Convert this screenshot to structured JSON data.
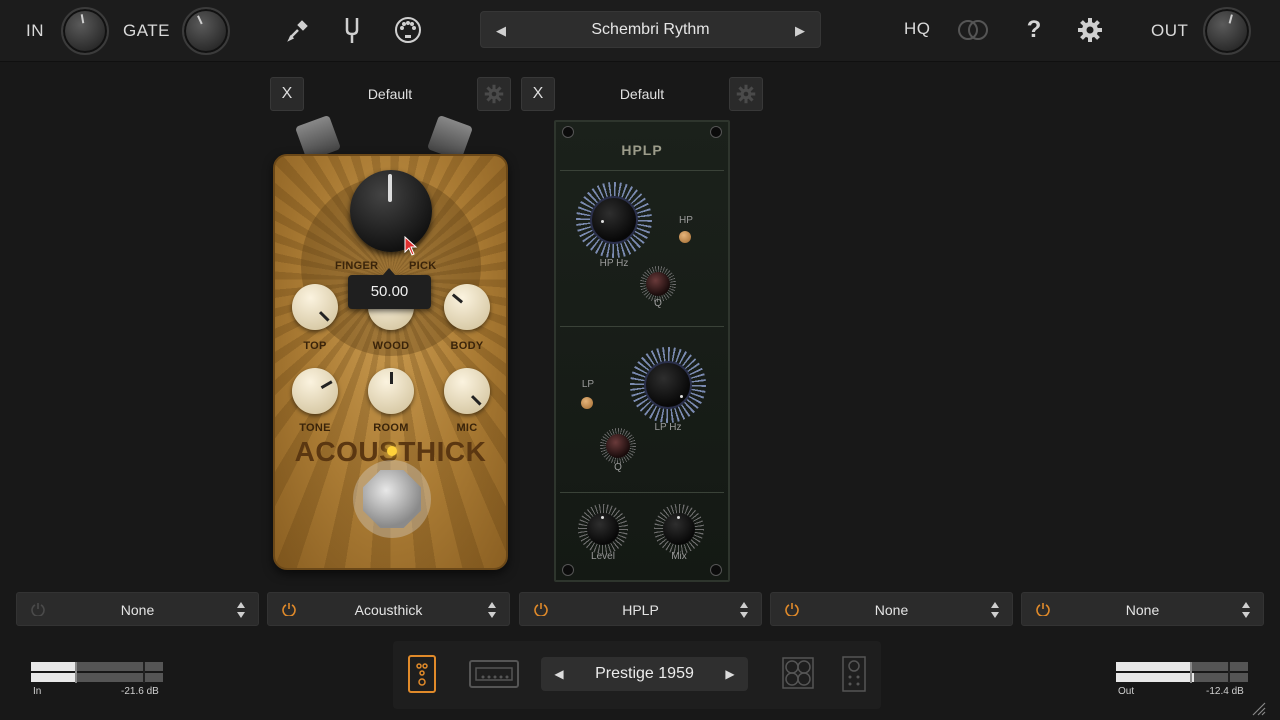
{
  "top_bar": {
    "in_label": "IN",
    "gate_label": "GATE",
    "preset_name": "Schembri Rythm",
    "hq_label": "HQ",
    "out_label": "OUT",
    "help_glyph": "?",
    "prev_glyph": "◀",
    "next_glyph": "▶",
    "icons": [
      "eyedropper-icon",
      "tuner-fork-icon",
      "midi-icon",
      "link-toggle-icon",
      "help-icon",
      "gear-icon"
    ]
  },
  "slots": [
    {
      "close_label": "X",
      "preset_label": "Default"
    },
    {
      "close_label": "X",
      "preset_label": "Default"
    }
  ],
  "pedal": {
    "brand": "ACOUSTHICK",
    "switch_left": "FINGER",
    "switch_right": "PICK",
    "knobs": [
      "TOP",
      "WOOD",
      "BODY",
      "TONE",
      "ROOM",
      "MIC"
    ],
    "tooltip_value": "50.00",
    "led_color": "#ffd23a"
  },
  "rack": {
    "title": "HPLP",
    "hp_hz_label": "HP Hz",
    "hp_label": "HP",
    "q_label": "Q",
    "lp_label": "LP",
    "lp_hz_label": "LP Hz",
    "q2_label": "Q",
    "level_label": "Level",
    "mix_label": "Mix"
  },
  "slot_selectors": [
    {
      "label": "None",
      "power_on": false
    },
    {
      "label": "Acousthick",
      "power_on": true
    },
    {
      "label": "HPLP",
      "power_on": true
    },
    {
      "label": "None",
      "power_on": true
    },
    {
      "label": "None",
      "power_on": true
    }
  ],
  "meters": {
    "in_label": "In",
    "in_value": "-21.6 dB",
    "out_label": "Out",
    "out_value": "-12.4 dB"
  },
  "bottom": {
    "cab_name": "Prestige 1959",
    "prev_glyph": "◀",
    "next_glyph": "▶",
    "icons": [
      "pedalboard-icon",
      "amp-icon",
      "cabinet-icon",
      "speaker-icon"
    ]
  },
  "colors": {
    "accent_orange": "#e08a2a",
    "background": "#181818"
  }
}
